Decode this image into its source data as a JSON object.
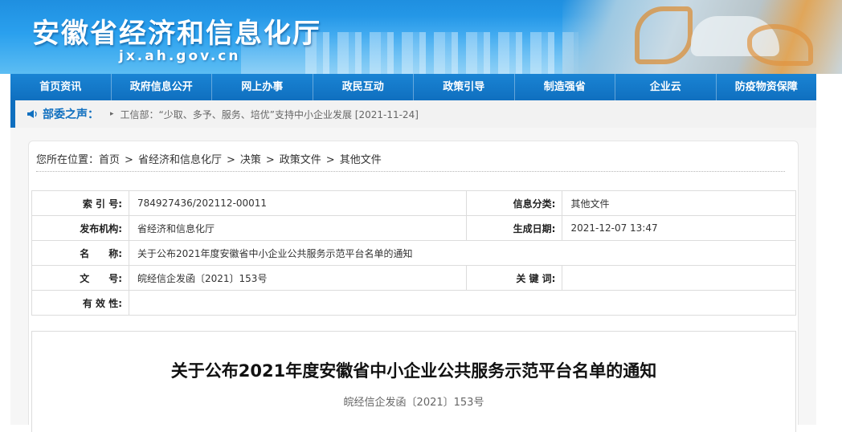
{
  "header": {
    "title": "安徽省经济和信息化厅",
    "url": "jx.ah.gov.cn"
  },
  "nav": {
    "items": [
      "首页资讯",
      "政府信息公开",
      "网上办事",
      "政民互动",
      "政策引导",
      "制造强省",
      "企业云",
      "防疫物资保障"
    ]
  },
  "ticker": {
    "label": "部委之声：",
    "text": "工信部：“少取、多予、服务、培优”支持中小企业发展 [2021-11-24]"
  },
  "breadcrumb": {
    "prefix": "您所在位置：",
    "items": [
      "首页",
      "省经济和信息化厅",
      "决策",
      "政策文件",
      "其他文件"
    ]
  },
  "meta": {
    "index_label": "索 引 号:",
    "index_value": "784927436/202112-00011",
    "category_label": "信息分类:",
    "category_value": "其他文件",
    "publisher_label": "发布机构:",
    "publisher_value": "省经济和信息化厅",
    "date_label": "生成日期:",
    "date_value": "2021-12-07 13:47",
    "name_label": "名　　称:",
    "name_value": "关于公布2021年度安徽省中小企业公共服务示范平台名单的通知",
    "docno_label": "文　　号:",
    "docno_value": "皖经信企发函〔2021〕153号",
    "keywords_label": "关 键 词:",
    "keywords_value": "",
    "validity_label": "有 效 性:",
    "validity_value": ""
  },
  "article": {
    "title": "关于公布2021年度安徽省中小企业公共服务示范平台名单的通知",
    "doc_number": "皖经信企发函〔2021〕153号"
  },
  "colors": {
    "brand_blue": "#0f6fbf",
    "nav_blue": "#1a84d4"
  }
}
